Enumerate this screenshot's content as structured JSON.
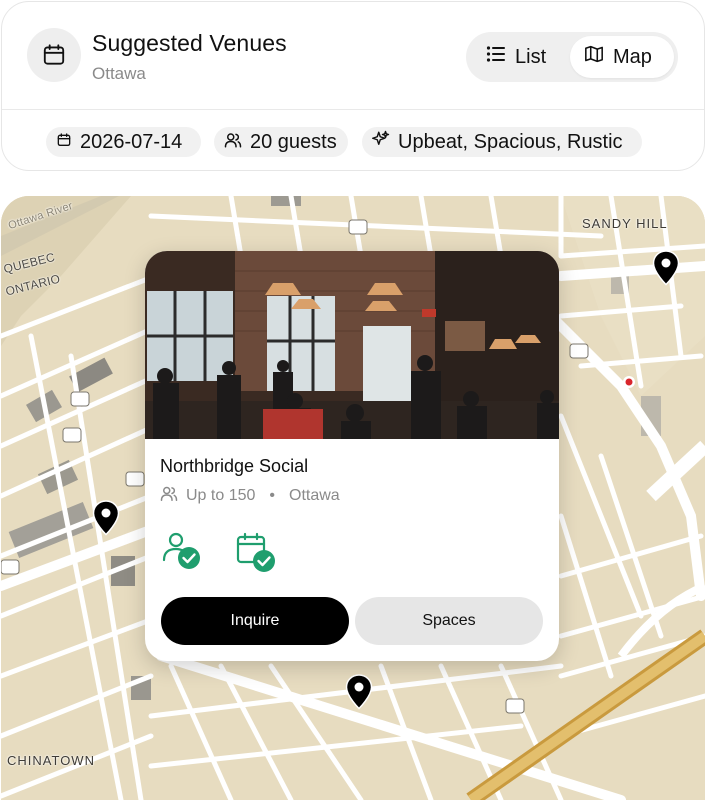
{
  "header": {
    "title": "Suggested Venues",
    "subtitle": "Ottawa",
    "app_icon": "calendar-icon",
    "view_toggle": [
      {
        "label": "List",
        "icon": "list-icon",
        "active": false
      },
      {
        "label": "Map",
        "icon": "map-icon",
        "active": true
      }
    ],
    "filters": {
      "date": "2026-07-14",
      "guests": "20 guests",
      "vibe": "Upbeat, Spacious, Rustic"
    }
  },
  "map": {
    "labels": {
      "sandy_hill": "SANDY HILL",
      "chinatown": "CHINATOWN",
      "quebec": "QUEBEC",
      "ontario": "ONTARIO",
      "ottawa_river": "Ottawa River"
    },
    "colors": {
      "land": "#e7dcc0",
      "road": "#ffffff",
      "highway": "#d9b25a",
      "pin": "#000000"
    }
  },
  "venue": {
    "name": "Northbridge Social",
    "capacity": "Up to 150",
    "separator": "•",
    "city": "Ottawa",
    "features": [
      "group-check-icon",
      "calendar-check-icon"
    ],
    "accent": "#1f9e6e",
    "actions": {
      "inquire": "Inquire",
      "spaces": "Spaces"
    }
  }
}
